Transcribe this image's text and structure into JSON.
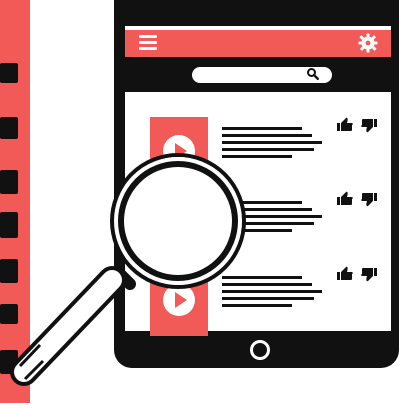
{
  "colors": {
    "accent": "#f25a57",
    "dark": "#111111",
    "light_accent": "#f7a79a"
  },
  "icons": {
    "menu": "menu-icon",
    "settings": "gear-icon",
    "search": "search-icon",
    "play": "play-icon",
    "like": "thumbs-up-icon",
    "dislike": "thumbs-down-icon",
    "home": "home-button-icon",
    "magnifier": "magnifying-glass-icon"
  },
  "video_rows": [
    {
      "id": "row1"
    },
    {
      "id": "row2"
    },
    {
      "id": "row3"
    }
  ]
}
